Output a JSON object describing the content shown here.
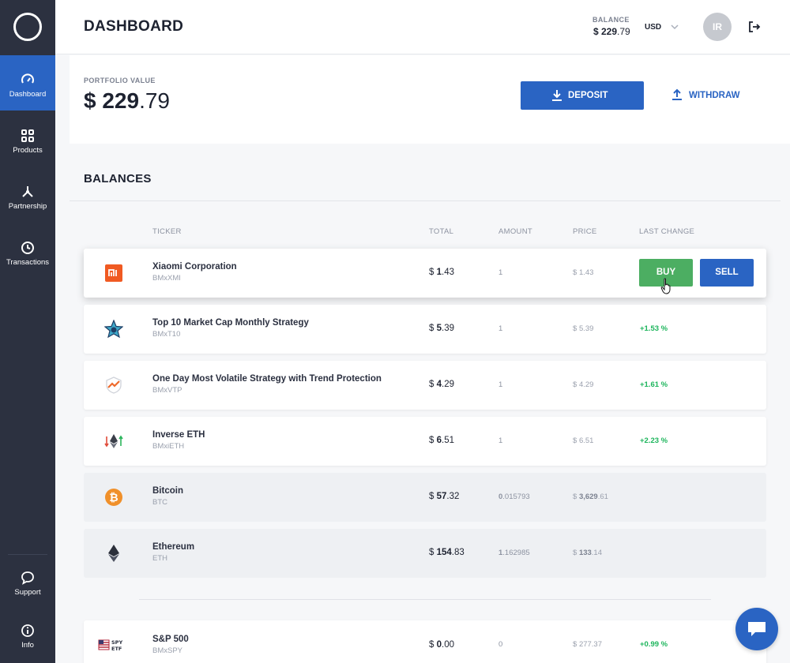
{
  "sidebar": {
    "items": [
      {
        "label": "Dashboard",
        "icon": "speedometer-icon",
        "active": true
      },
      {
        "label": "Products",
        "icon": "grid-icon"
      },
      {
        "label": "Partnership",
        "icon": "network-icon"
      },
      {
        "label": "Transactions",
        "icon": "clock-icon"
      },
      {
        "label": "Support",
        "icon": "chat-bubble-icon"
      },
      {
        "label": "Info",
        "icon": "info-icon"
      }
    ]
  },
  "header": {
    "title": "DASHBOARD",
    "balance_label": "BALANCE",
    "balance_whole": "$ 229",
    "balance_cents": ".79",
    "currency": "USD",
    "avatar_initials": "IR"
  },
  "portfolio": {
    "label": "PORTFOLIO VALUE",
    "value_whole": "$ 229",
    "value_cents": ".79",
    "deposit_label": "DEPOSIT",
    "withdraw_label": "WITHDRAW"
  },
  "balances": {
    "title": "BALANCES",
    "columns": {
      "ticker": "TICKER",
      "total": "TOTAL",
      "amount": "AMOUNT",
      "price": "PRICE",
      "last_change": "LAST CHANGE"
    },
    "rows": [
      {
        "name": "Xiaomi Corporation",
        "ticker": "BMxXMI",
        "total_pre": "$ ",
        "total_bold": "1",
        "total_rest": ".43",
        "amount_bold": "",
        "amount_rest": "1",
        "price_pre": "$ ",
        "price_bold": "",
        "price_rest": "1.43",
        "change": "",
        "buy_label": "BUY",
        "sell_label": "SELL",
        "icon": "xiaomi-logo-icon"
      },
      {
        "name": "Top 10 Market Cap Monthly Strategy",
        "ticker": "BMxT10",
        "total_pre": "$ ",
        "total_bold": "5",
        "total_rest": ".39",
        "amount_bold": "",
        "amount_rest": "1",
        "price_pre": "$ ",
        "price_bold": "",
        "price_rest": "5.39",
        "change": "+1.53 %",
        "icon": "star-badge-icon"
      },
      {
        "name": "One Day Most Volatile Strategy with Trend Protection",
        "ticker": "BMxVTP",
        "total_pre": "$ ",
        "total_bold": "4",
        "total_rest": ".29",
        "amount_bold": "",
        "amount_rest": "1",
        "price_pre": "$ ",
        "price_bold": "",
        "price_rest": "4.29",
        "change": "+1.61 %",
        "icon": "shield-trend-icon"
      },
      {
        "name": "Inverse ETH",
        "ticker": "BMxiETH",
        "total_pre": "$ ",
        "total_bold": "6",
        "total_rest": ".51",
        "amount_bold": "",
        "amount_rest": "1",
        "price_pre": "$ ",
        "price_bold": "",
        "price_rest": "6.51",
        "change": "+2.23 %",
        "icon": "inverse-eth-icon"
      },
      {
        "name": "Bitcoin",
        "ticker": "BTC",
        "total_pre": "$ ",
        "total_bold": "57",
        "total_rest": ".32",
        "amount_bold": "0",
        "amount_rest": ".015793",
        "price_pre": "$ ",
        "price_bold": "3,629",
        "price_rest": ".61",
        "change": "",
        "icon": "bitcoin-icon"
      },
      {
        "name": "Ethereum",
        "ticker": "ETH",
        "total_pre": "$ ",
        "total_bold": "154",
        "total_rest": ".83",
        "amount_bold": "1",
        "amount_rest": ".162985",
        "price_pre": "$ ",
        "price_bold": "133",
        "price_rest": ".14",
        "change": "",
        "icon": "ethereum-icon"
      },
      {
        "name": "S&P 500",
        "ticker": "BMxSPY",
        "total_pre": "$ ",
        "total_bold": "0",
        "total_rest": ".00",
        "amount_bold": "",
        "amount_rest": "0",
        "price_pre": "$ ",
        "price_bold": "",
        "price_rest": "277.37",
        "change": "+0.99 %",
        "icon": "spy-etf-icon",
        "icon_text_top": "SPY",
        "icon_text_bottom": "ETF"
      }
    ]
  },
  "colors": {
    "primary": "#2a64c3",
    "buy": "#4cae62",
    "positive": "#1db55c",
    "sidebar": "#2c3140"
  }
}
